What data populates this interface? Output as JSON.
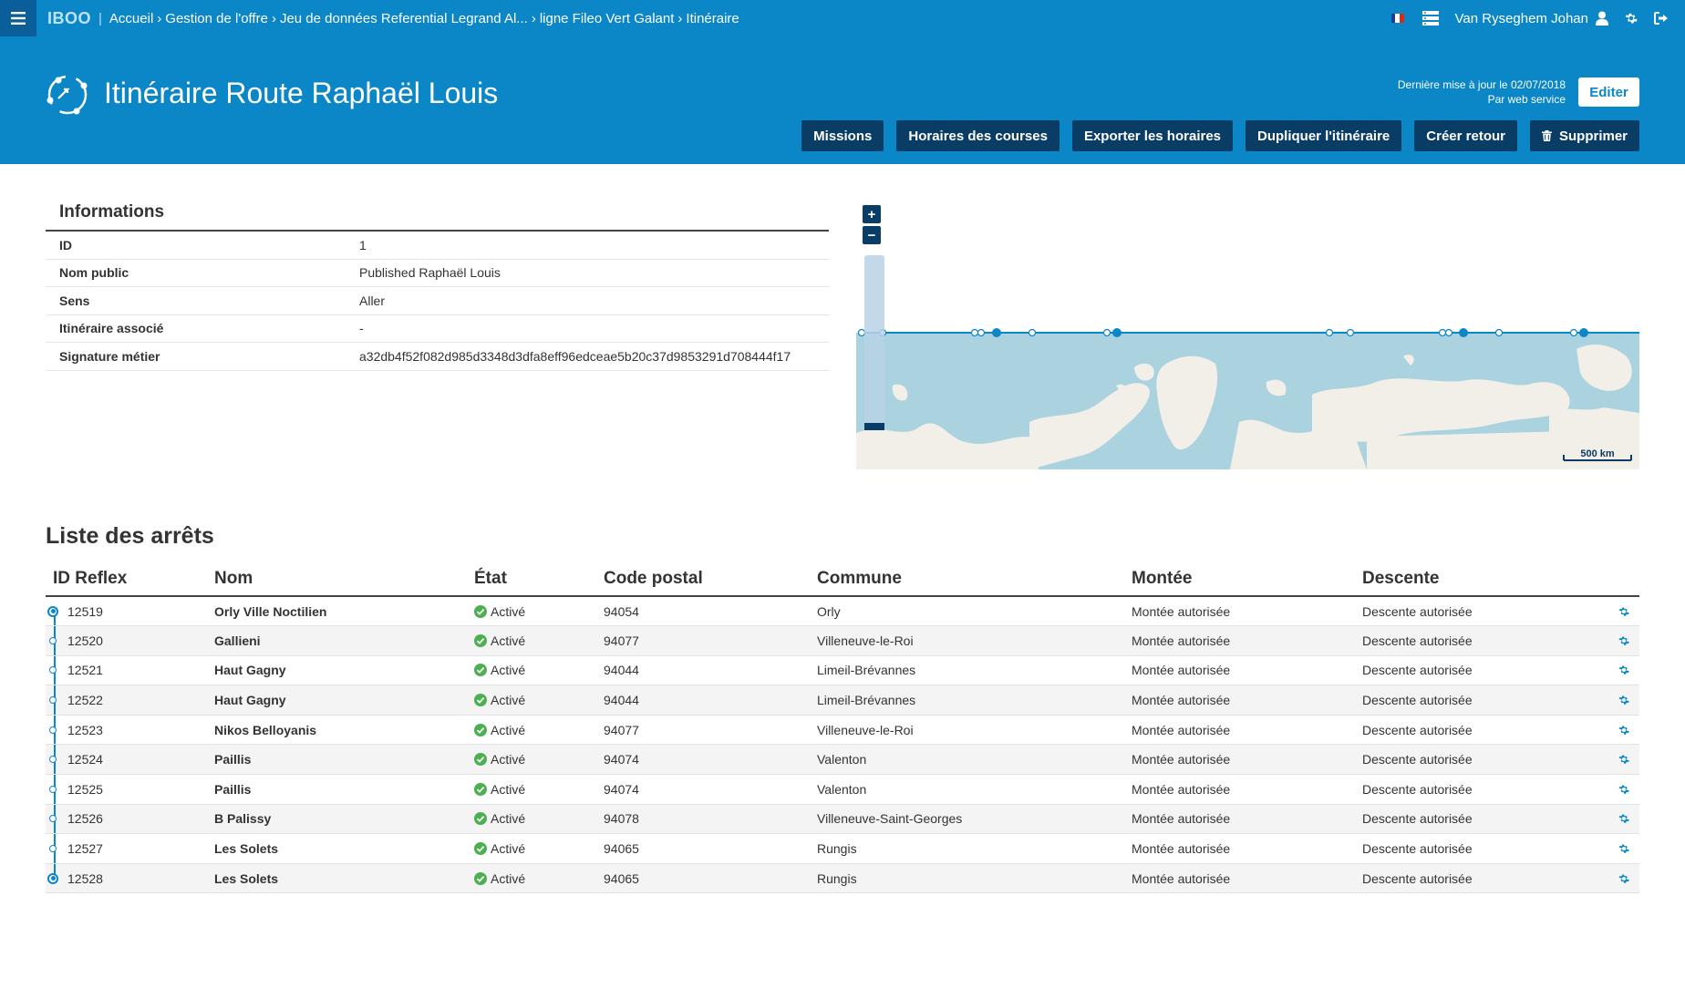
{
  "app": {
    "brand": "IBOO"
  },
  "breadcrumb": [
    "Accueil",
    "Gestion de l'offre",
    "Jeu de données Referential Legrand Al...",
    "ligne Fileo Vert Galant",
    "Itinéraire"
  ],
  "user": {
    "name": "Van Ryseghem Johan"
  },
  "header": {
    "title": "Itinéraire Route Raphaël Louis",
    "update_line1": "Dernière mise à jour le 02/07/2018",
    "update_line2": "Par web service",
    "edit_label": "Editer",
    "actions": [
      "Missions",
      "Horaires des courses",
      "Exporter les horaires",
      "Dupliquer l'itinéraire",
      "Créer retour",
      "Supprimer"
    ]
  },
  "info": {
    "title": "Informations",
    "rows": [
      {
        "label": "ID",
        "value": "1"
      },
      {
        "label": "Nom public",
        "value": "Published Raphaël Louis"
      },
      {
        "label": "Sens",
        "value": "Aller"
      },
      {
        "label": "Itinéraire associé",
        "value": "-"
      },
      {
        "label": "Signature métier",
        "value": "a32db4f52f082d985d3348d3dfa8eff96edceae5b20c37d9853291d708444f17"
      }
    ]
  },
  "map": {
    "zoom_in": "+",
    "zoom_out": "−",
    "scale_label": "500 km",
    "land_color": "#f2efe9",
    "sea_color": "#aad3df"
  },
  "stops": {
    "title": "Liste des arrêts",
    "columns": [
      "ID Reflex",
      "Nom",
      "État",
      "Code postal",
      "Commune",
      "Montée",
      "Descente"
    ],
    "rows": [
      {
        "id": "12519",
        "name": "Orly Ville Noctilien",
        "state": "Activé",
        "cp": "94054",
        "commune": "Orly",
        "montee": "Montée autorisée",
        "descente": "Descente autorisée"
      },
      {
        "id": "12520",
        "name": "Gallieni",
        "state": "Activé",
        "cp": "94077",
        "commune": "Villeneuve-le-Roi",
        "montee": "Montée autorisée",
        "descente": "Descente autorisée"
      },
      {
        "id": "12521",
        "name": "Haut Gagny",
        "state": "Activé",
        "cp": "94044",
        "commune": "Limeil-Brévannes",
        "montee": "Montée autorisée",
        "descente": "Descente autorisée"
      },
      {
        "id": "12522",
        "name": "Haut Gagny",
        "state": "Activé",
        "cp": "94044",
        "commune": "Limeil-Brévannes",
        "montee": "Montée autorisée",
        "descente": "Descente autorisée"
      },
      {
        "id": "12523",
        "name": "Nikos Belloyanis",
        "state": "Activé",
        "cp": "94077",
        "commune": "Villeneuve-le-Roi",
        "montee": "Montée autorisée",
        "descente": "Descente autorisée"
      },
      {
        "id": "12524",
        "name": "Paillis",
        "state": "Activé",
        "cp": "94074",
        "commune": "Valenton",
        "montee": "Montée autorisée",
        "descente": "Descente autorisée"
      },
      {
        "id": "12525",
        "name": "Paillis",
        "state": "Activé",
        "cp": "94074",
        "commune": "Valenton",
        "montee": "Montée autorisée",
        "descente": "Descente autorisée"
      },
      {
        "id": "12526",
        "name": "B Palissy",
        "state": "Activé",
        "cp": "94078",
        "commune": "Villeneuve-Saint-Georges",
        "montee": "Montée autorisée",
        "descente": "Descente autorisée"
      },
      {
        "id": "12527",
        "name": "Les Solets",
        "state": "Activé",
        "cp": "94065",
        "commune": "Rungis",
        "montee": "Montée autorisée",
        "descente": "Descente autorisée"
      },
      {
        "id": "12528",
        "name": "Les Solets",
        "state": "Activé",
        "cp": "94065",
        "commune": "Rungis",
        "montee": "Montée autorisée",
        "descente": "Descente autorisée"
      }
    ]
  },
  "colors": {
    "primary": "#0b86c7",
    "dark_button": "#0a3d66",
    "success": "#4caf50"
  }
}
